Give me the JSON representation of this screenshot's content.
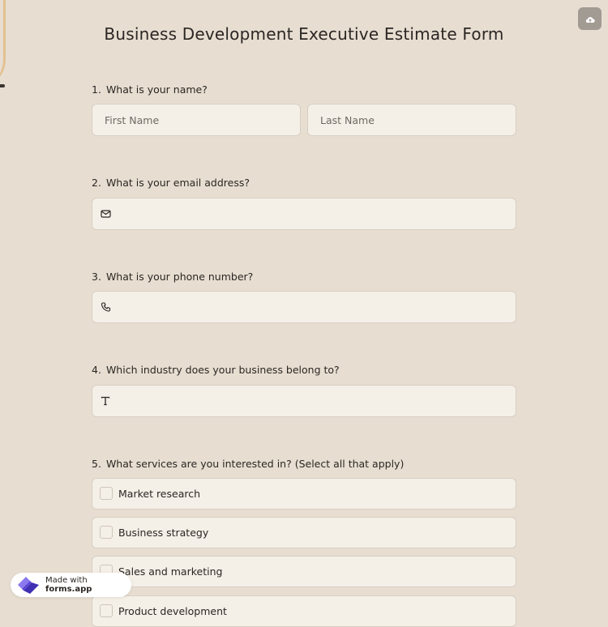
{
  "form": {
    "title": "Business Development Executive Estimate Form"
  },
  "questions": [
    {
      "number": "1.",
      "label": "What is your name?",
      "first_placeholder": "First Name",
      "last_placeholder": "Last Name"
    },
    {
      "number": "2.",
      "label": "What is your email address?",
      "icon": "envelope-icon"
    },
    {
      "number": "3.",
      "label": "What is your phone number?",
      "icon": "phone-icon"
    },
    {
      "number": "4.",
      "label": "Which industry does your business belong to?",
      "icon": "text-t-icon"
    },
    {
      "number": "5.",
      "label": "What services are you interested in? (Select all that apply)",
      "options": [
        "Market research",
        "Business strategy",
        "Sales and marketing",
        "Product development"
      ]
    }
  ],
  "badge": {
    "prefix": "Made with",
    "brand": "forms.app"
  },
  "colors": {
    "background": "#e7ded1",
    "field": "#f4efe7",
    "brand_purple": "#5b45d6"
  },
  "icons": {
    "upload": "cloud-upload-icon",
    "logo": "forms-app-logo-icon"
  }
}
